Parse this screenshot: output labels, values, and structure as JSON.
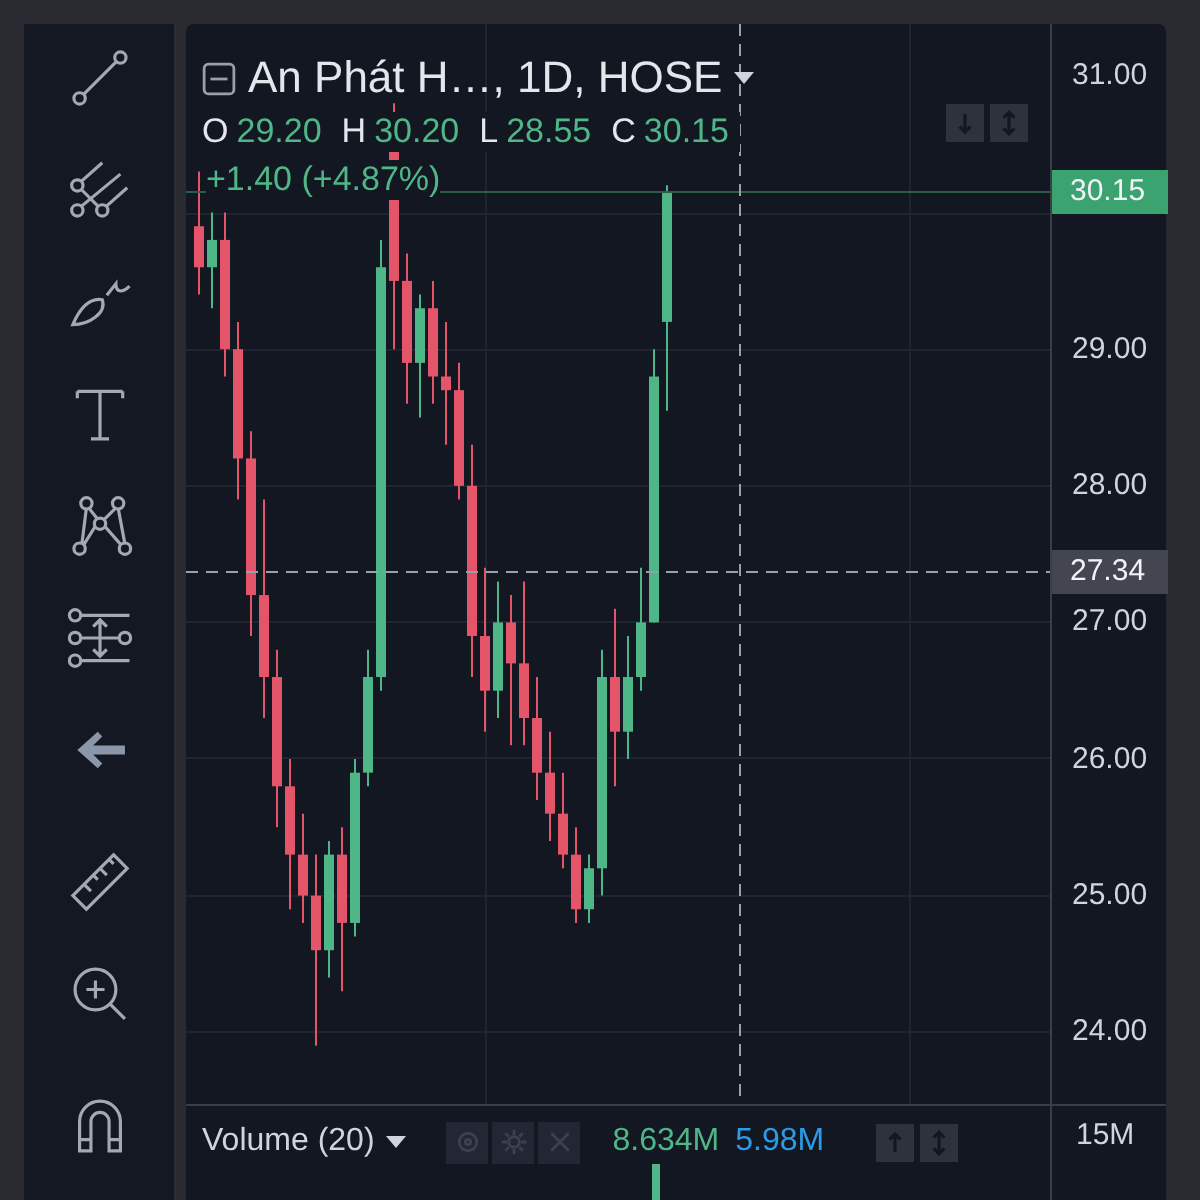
{
  "legend": {
    "title": "An Phát H…, 1D, HOSE",
    "ohlc": [
      {
        "label": "O",
        "value": "29.20"
      },
      {
        "label": "H",
        "value": "30.20"
      },
      {
        "label": "L",
        "value": "28.55"
      },
      {
        "label": "C",
        "value": "30.15"
      }
    ],
    "change": "+1.40 (+4.87%)"
  },
  "price_axis": {
    "ticks": [
      "31.00",
      "29.00",
      "28.00",
      "27.00",
      "26.00",
      "25.00",
      "24.00"
    ],
    "last_price": "30.15",
    "crosshair_price": "27.34"
  },
  "volume": {
    "title": "Volume (20)",
    "value": "8.634M",
    "average": "5.98M",
    "axis_tick": "15M"
  }
}
